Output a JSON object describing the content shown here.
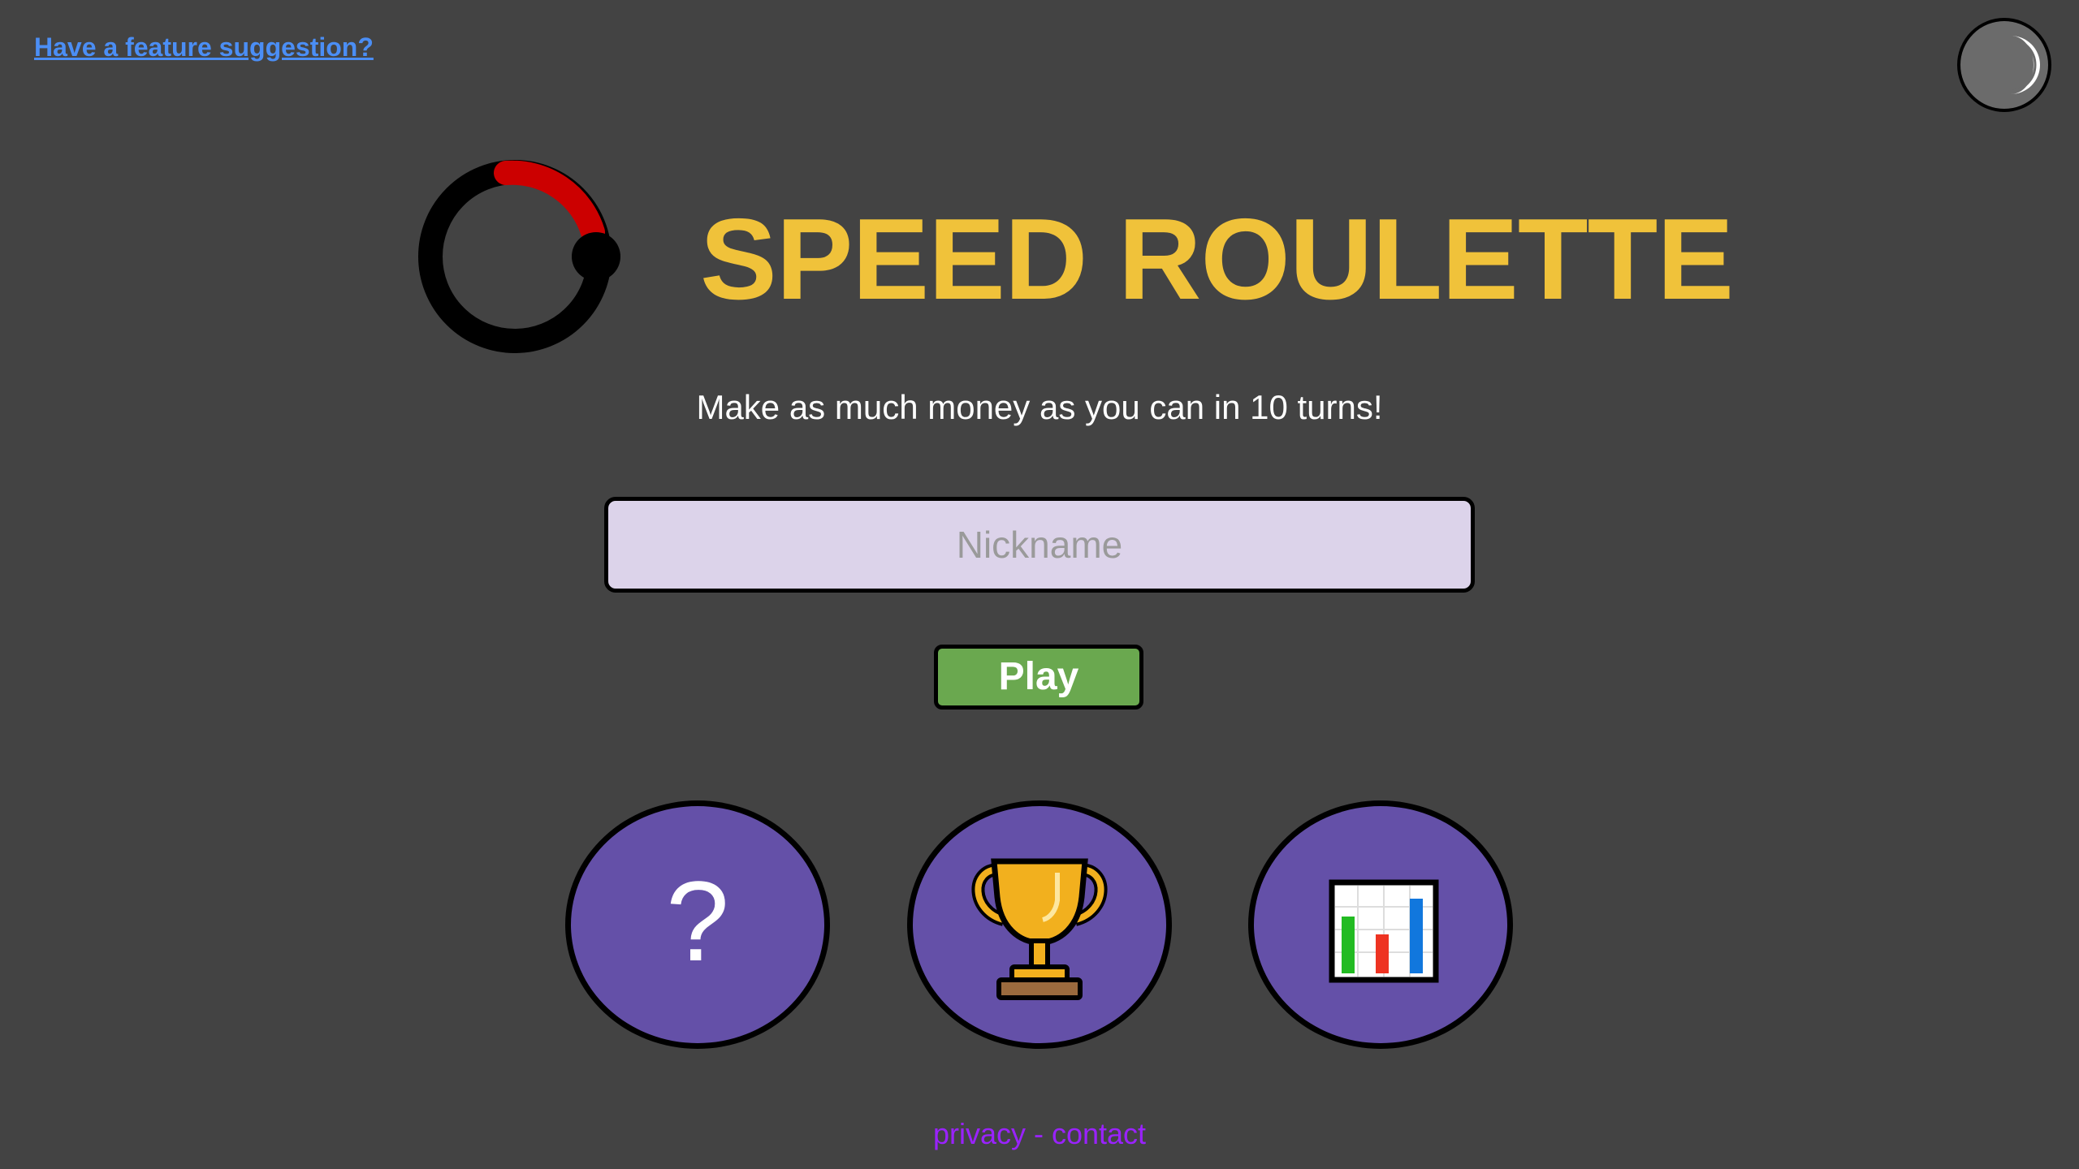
{
  "links": {
    "feature_suggestion": "Have a feature suggestion?"
  },
  "header": {
    "title": "SPEED ROULETTE",
    "subtitle": "Make as much money as you can in 10 turns!"
  },
  "form": {
    "nickname_placeholder": "Nickname",
    "nickname_value": "",
    "play_label": "Play"
  },
  "menu": {
    "help_label": "?",
    "trophy_icon": "trophy-icon",
    "stats_icon": "bar-chart-icon"
  },
  "footer": {
    "privacy": "privacy",
    "separator": " - ",
    "contact": "contact"
  },
  "colors": {
    "background": "#434343",
    "title": "#f0c23a",
    "input_bg": "#dcd3ea",
    "play_button": "#6aa84f",
    "menu_button": "#6450a8",
    "link": "#4b8ef5",
    "footer_link": "#9a22ff",
    "logo_accent": "#cc0000"
  },
  "icons": {
    "theme_toggle": "crescent-moon-icon",
    "logo": "roulette-timer-logo"
  }
}
